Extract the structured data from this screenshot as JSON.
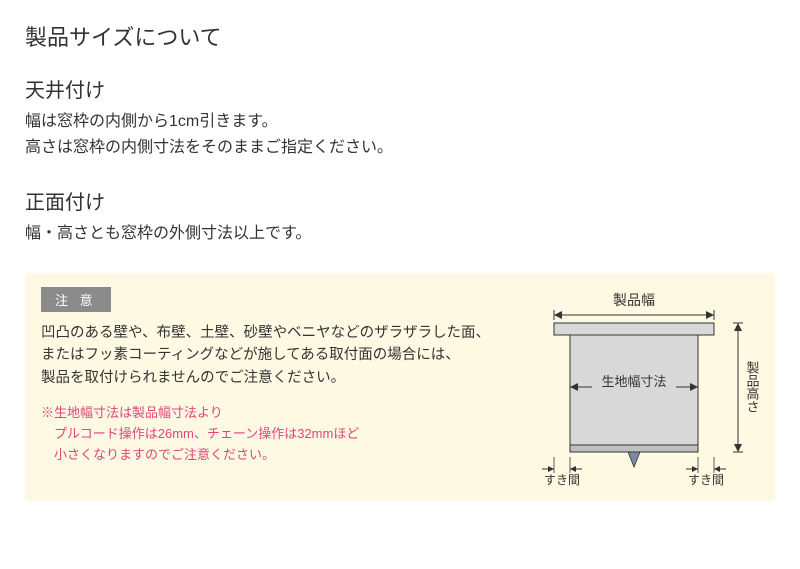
{
  "title": "製品サイズについて",
  "sections": [
    {
      "heading": "天井付け",
      "lines": [
        "幅は窓枠の内側から1cm引きます。",
        "高さは窓枠の内側寸法をそのままご指定ください。"
      ]
    },
    {
      "heading": "正面付け",
      "lines": [
        "幅・高さとも窓枠の外側寸法以上です。"
      ]
    }
  ],
  "notice": {
    "badge": "注 意",
    "text_lines": [
      "凹凸のある壁や、布壁、土壁、砂壁やベニヤなどのザラザラした面、",
      "またはフッ素コーティングなどが施してある取付面の場合には、",
      "製品を取付けられませんのでご注意ください。"
    ],
    "warning_lines": [
      "※生地幅寸法は製品幅寸法より",
      "プルコード操作は26mm、チェーン操作は32mmほど",
      "小さくなりますのでご注意ください。"
    ]
  },
  "diagram": {
    "product_width_label": "製品幅",
    "product_height_label": "製品高さ",
    "fabric_width_label": "生地幅寸法",
    "gap_label": "すき間"
  }
}
